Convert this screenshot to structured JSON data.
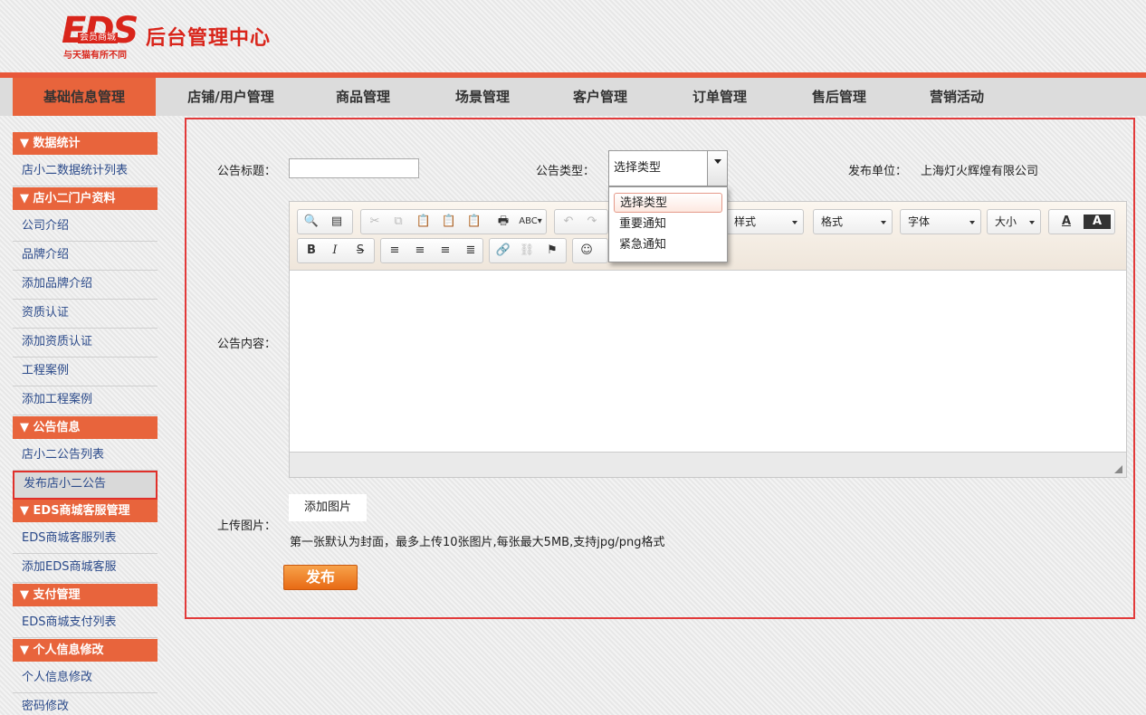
{
  "header": {
    "logo_text": "EDS",
    "logo_sub": "会员商城",
    "title": "后台管理中心",
    "slogan": "与天猫有所不同"
  },
  "nav": {
    "items": [
      "基础信息管理",
      "店铺/用户管理",
      "商品管理",
      "场景管理",
      "客户管理",
      "订单管理",
      "售后管理",
      "营销活动"
    ],
    "active_index": 0
  },
  "sidebar": {
    "groups": [
      {
        "title": "▼ 数据统计",
        "links": [
          "店小二数据统计列表"
        ]
      },
      {
        "title": "▼ 店小二门户资料",
        "links": [
          "公司介绍",
          "品牌介绍",
          "添加品牌介绍",
          "资质认证",
          "添加资质认证",
          "工程案例",
          "添加工程案例"
        ]
      },
      {
        "title": "▼ 公告信息",
        "links": [
          "店小二公告列表",
          "发布店小二公告"
        ]
      },
      {
        "title": "▼ EDS商城客服管理",
        "links": [
          "EDS商城客服列表",
          "添加EDS商城客服"
        ]
      },
      {
        "title": "▼ 支付管理",
        "links": [
          "EDS商城支付列表"
        ]
      },
      {
        "title": "▼ 个人信息修改",
        "links": [
          "个人信息修改",
          "密码修改"
        ]
      }
    ],
    "selected": "发布店小二公告"
  },
  "form": {
    "title_label": "公告标题：",
    "title_value": "",
    "type_label": "公告类型：",
    "type_selected": "选择类型",
    "type_options": [
      "选择类型",
      "重要通知",
      "紧急通知"
    ],
    "unit_label": "发布单位：",
    "unit_value": "上海灯火辉煌有限公司",
    "content_label": "公告内容：",
    "upload_label": "上传图片：",
    "add_image": "添加图片",
    "upload_hint": "第一张默认为封面，最多上传10张图片,每张最大5MB,支持jpg/png格式",
    "publish": "发布"
  },
  "editor": {
    "style_combo": "样式",
    "format_combo": "格式",
    "font_combo": "字体",
    "size_combo": "大小",
    "text_color": "A",
    "bg_color": "A"
  },
  "colors": {
    "accent": "#e8643c",
    "border_red": "#e23a3a",
    "link": "#2b4a8a",
    "publish": "#e86a14"
  }
}
